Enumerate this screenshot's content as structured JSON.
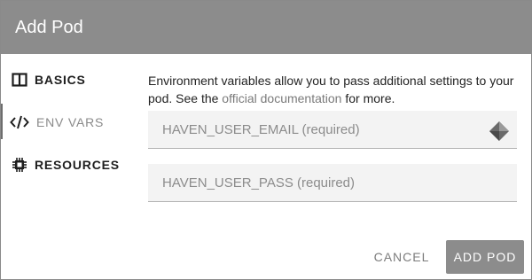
{
  "dialog": {
    "title": "Add Pod"
  },
  "nav": {
    "items": [
      {
        "label": "BASICS",
        "icon": "columns-icon"
      },
      {
        "label": "ENV VARS",
        "icon": "code-icon"
      },
      {
        "label": "RESOURCES",
        "icon": "chip-icon"
      }
    ],
    "active_index": 1
  },
  "content": {
    "description_before": "Environment variables allow you to pass additional settings to your pod. See the ",
    "link_text": "official documentation",
    "description_after": " for more.",
    "fields": [
      {
        "placeholder": "HAVEN_USER_EMAIL (required)",
        "value": ""
      },
      {
        "placeholder": "HAVEN_USER_PASS (required)",
        "value": ""
      }
    ]
  },
  "actions": {
    "cancel_label": "CANCEL",
    "submit_label": "ADD POD"
  }
}
